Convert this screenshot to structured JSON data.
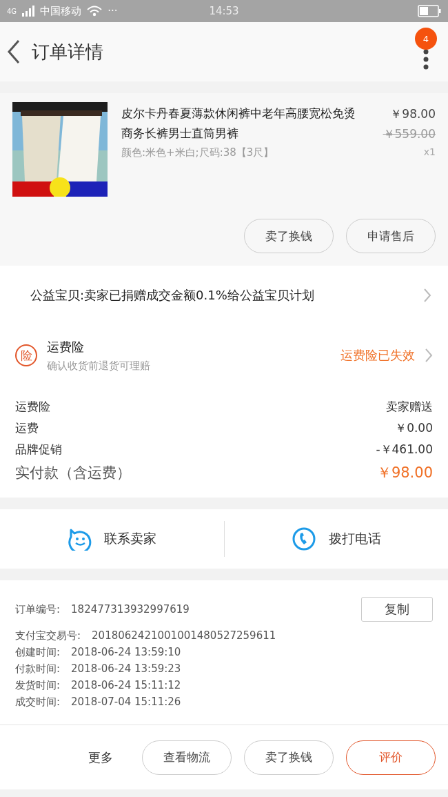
{
  "status_bar": {
    "network": "4G",
    "carrier": "中国移动",
    "more": "···",
    "time": "14:53"
  },
  "header": {
    "title": "订单详情",
    "badge": "4"
  },
  "product": {
    "image": {
      "kind": "picture"
    },
    "title": "皮尔卡丹春夏薄款休闲裤中老年高腰宽松免烫商务长裤男士直筒男裤",
    "spec": "颜色:米色+米白;尺码:38【3尺】",
    "price": "￥98.00",
    "original_price": "￥559.00",
    "quantity": "x1",
    "buttons": [
      "卖了换钱",
      "申请售后"
    ]
  },
  "charity": {
    "text": "公益宝贝:卖家已捐赠成交金额0.1%给公益宝贝计划"
  },
  "insurance": {
    "icon": "险",
    "title": "运费险",
    "subtitle": "确认收货前退货可理赔",
    "status": "运费险已失效"
  },
  "fees": [
    {
      "label": "运费险",
      "value": "卖家赠送",
      "kind": "plain"
    },
    {
      "label": "运费",
      "value": "￥0.00",
      "kind": "plain"
    },
    {
      "label": "品牌促销",
      "value": "-￥461.00",
      "kind": "plain"
    },
    {
      "label": "实付款（含运费）",
      "value": "￥98.00",
      "kind": "total"
    }
  ],
  "contact": [
    {
      "label": "联系卖家",
      "kind": "chat"
    },
    {
      "label": "拨打电话",
      "kind": "phone"
    }
  ],
  "order_info": {
    "order_no_label": "订单编号:",
    "order_no": "182477313932997619",
    "copy_button": "复制",
    "rows": [
      {
        "label": "支付宝交易号:",
        "value": "2018062421001001480527259611"
      },
      {
        "label": "创建时间:",
        "value": "2018-06-24 13:59:10"
      },
      {
        "label": "付款时间:",
        "value": "2018-06-24 13:59:23"
      },
      {
        "label": "发货时间:",
        "value": "2018-06-24 15:11:12"
      },
      {
        "label": "成交时间:",
        "value": "2018-07-04 15:11:26"
      }
    ]
  },
  "bottom_bar": {
    "more": "更多",
    "buttons": [
      {
        "label": "查看物流",
        "primary": false
      },
      {
        "label": "卖了换钱",
        "primary": false
      },
      {
        "label": "评价",
        "primary": true
      }
    ]
  }
}
